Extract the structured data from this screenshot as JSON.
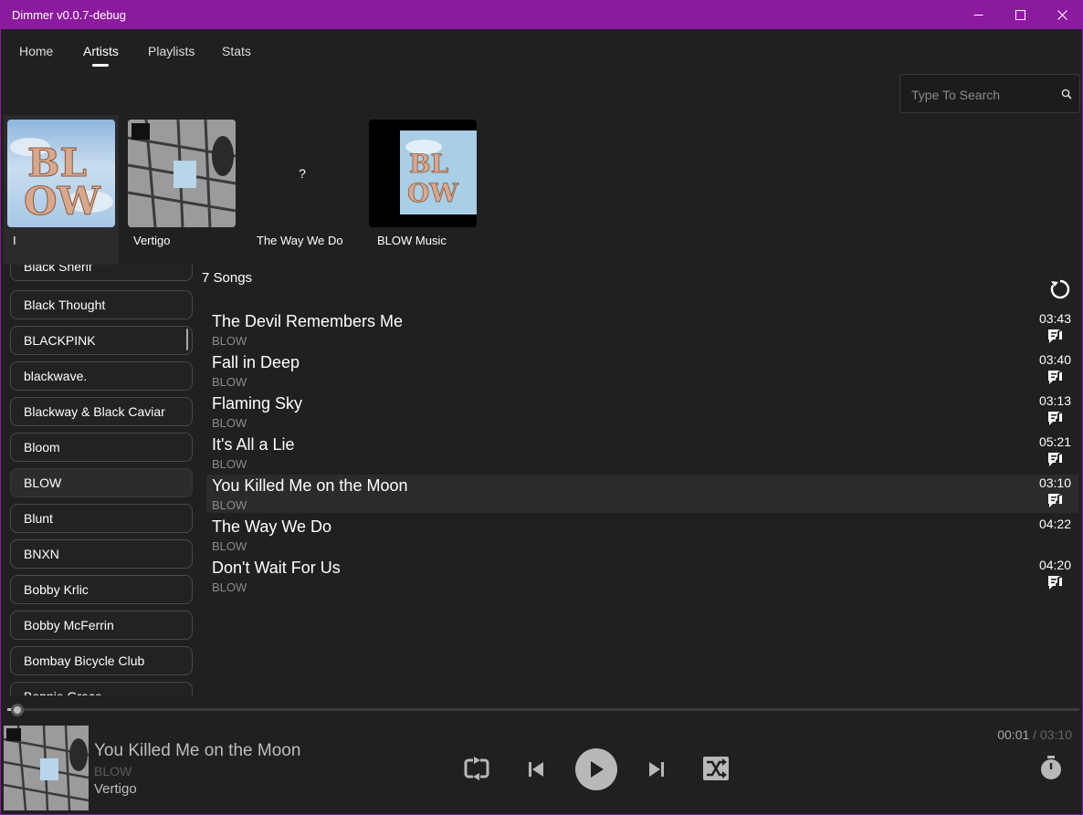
{
  "window": {
    "title": "Dimmer v0.0.7-debug"
  },
  "nav": {
    "tabs": [
      "Home",
      "Artists",
      "Playlists",
      "Stats"
    ],
    "active": "Artists"
  },
  "search": {
    "placeholder": "Type To Search",
    "value": ""
  },
  "albums": [
    {
      "name": "I",
      "art": "blow-i-cover"
    },
    {
      "name": "Vertigo",
      "art": "vertigo-cover"
    },
    {
      "name": "The Way We Do",
      "art": "missing-art",
      "placeholder": "?"
    },
    {
      "name": "BLOW Music",
      "art": "blow-music-cover"
    }
  ],
  "artists": [
    "Black Sherif",
    "Black Thought",
    "BLACKPINK",
    "blackwave.",
    "Blackway & Black Caviar",
    "Bloom",
    "BLOW",
    "Blunt",
    "BNXN",
    "Bobby Krlic",
    "Bobby McFerrin",
    "Bombay Bicycle Club",
    "Bonnie Grace"
  ],
  "selected_artist": "BLOW",
  "songs_header": "7 Songs",
  "songs": [
    {
      "title": "The Devil Remembers Me",
      "artist": "BLOW",
      "duration": "03:43",
      "lyrics": true
    },
    {
      "title": "Fall in Deep",
      "artist": "BLOW",
      "duration": "03:40",
      "lyrics": true
    },
    {
      "title": "Flaming Sky",
      "artist": "BLOW",
      "duration": "03:13",
      "lyrics": true
    },
    {
      "title": "It's All a Lie",
      "artist": "BLOW",
      "duration": "05:21",
      "lyrics": true
    },
    {
      "title": "You Killed Me on the Moon",
      "artist": "BLOW",
      "duration": "03:10",
      "lyrics": true
    },
    {
      "title": "The Way We Do",
      "artist": "BLOW",
      "duration": "04:22",
      "lyrics": false
    },
    {
      "title": "Don't Wait For Us",
      "artist": "BLOW",
      "duration": "04:20",
      "lyrics": true
    }
  ],
  "highlighted_song": 4,
  "now_playing": {
    "title": "You Killed Me on the Moon",
    "artist": "BLOW",
    "album": "Vertigo",
    "current": "00:01",
    "separator": " / ",
    "total": "03:10",
    "progress": 0.005
  },
  "controls": [
    "repeat-icon",
    "previous-icon",
    "play-icon",
    "next-icon",
    "shuffle-icon",
    "timer-icon"
  ],
  "colors": {
    "accent": "#8b1a9e",
    "background": "#202020",
    "muted_text": "#8a8a8a"
  }
}
